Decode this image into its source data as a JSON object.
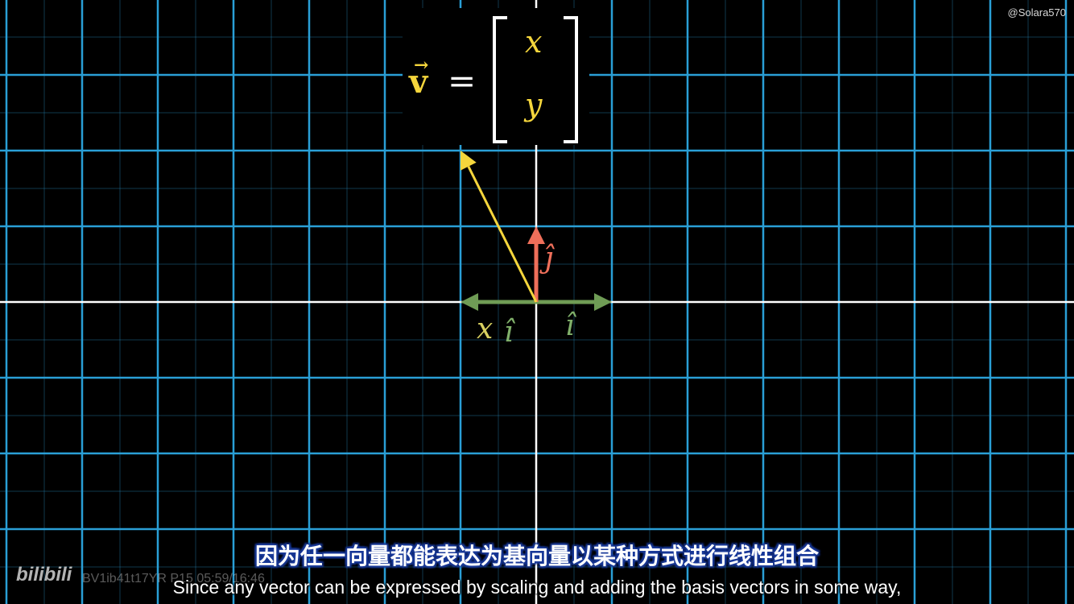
{
  "watermark": "@Solara570",
  "equation": {
    "vector_symbol": "v",
    "arrow": "→",
    "equals": "=",
    "entry_x": "x",
    "entry_y": "y"
  },
  "labels": {
    "j_hat": "ĵ",
    "i_hat": "î",
    "scalar_x": "x",
    "scaled_i_hat": "î"
  },
  "subtitle_cn": "因为任一向量都能表达为基向量以某种方式进行线性组合",
  "subtitle_en": "Since any vector can be expressed by scaling and adding the basis vectors in some way,",
  "logo": "bilibili",
  "video_info": "BV1ib41t17YR P15 05:59/16:46",
  "colors": {
    "background": "#000000",
    "grid": "#2a9fd6",
    "axis": "#ffffff",
    "vector_v": "#f5d63c",
    "i_hat": "#6f9c55",
    "j_hat": "#ef6f5a"
  },
  "vectors": {
    "i_hat": [
      1,
      0
    ],
    "j_hat": [
      0,
      1
    ],
    "x_i_hat": [
      -1,
      0
    ],
    "v": [
      -1,
      2
    ]
  }
}
